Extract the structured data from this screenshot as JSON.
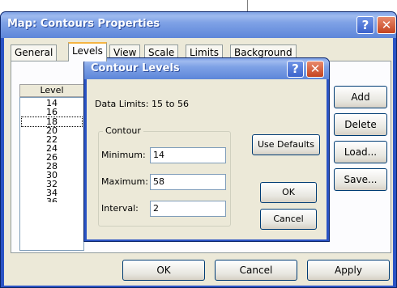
{
  "main_dialog": {
    "title": "Map: Contours Properties",
    "help_glyph": "?",
    "close_glyph": "✕",
    "tabs": [
      "General",
      "Levels",
      "View",
      "Scale",
      "Limits",
      "Background"
    ],
    "selected_tab": "Levels",
    "level_column_header": "Level",
    "levels": [
      "14",
      "16",
      "18",
      "20",
      "22",
      "24",
      "26",
      "28",
      "30",
      "32",
      "34",
      "36"
    ],
    "selected_level": "18",
    "side_buttons": {
      "add": "Add",
      "delete": "Delete",
      "load": "Load...",
      "save": "Save..."
    },
    "footer_buttons": {
      "ok": "OK",
      "cancel": "Cancel",
      "apply": "Apply"
    }
  },
  "contour_levels_dialog": {
    "title": "Contour Levels",
    "data_limits": "Data Limits: 15 to 56",
    "group_label": "Contour",
    "minimum_label": "Minimum:",
    "minimum_value": "14",
    "maximum_label": "Maximum:",
    "maximum_value": "58",
    "interval_label": "Interval:",
    "interval_value": "2",
    "use_defaults_label": "Use Defaults",
    "ok_label": "OK",
    "cancel_label": "Cancel"
  },
  "colors": {
    "title_blue": "#2a53c4",
    "dialog_face": "#ece9d8",
    "close_red": "#c4431f"
  }
}
